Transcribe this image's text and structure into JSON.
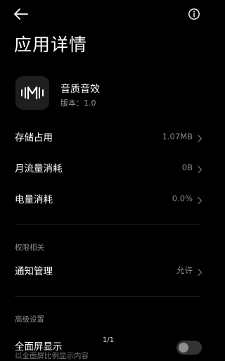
{
  "header": {
    "title": "应用详情",
    "back_icon": "arrow-left-icon",
    "info_icon": "info-circle-icon"
  },
  "app": {
    "name": "音质音效",
    "version": "版本：1.0",
    "icon": "sound-wave-m-icon"
  },
  "usage_rows": [
    {
      "label": "存储占用",
      "value": "1.07MB"
    },
    {
      "label": "月流量消耗",
      "value": "0B"
    },
    {
      "label": "电量消耗",
      "value": "0.0%"
    }
  ],
  "permissions": {
    "section_title": "权限相关",
    "notification_label": "通知管理",
    "notification_value": "允许"
  },
  "advanced": {
    "section_title": "高级设置",
    "fullscreen_label": "全面屏显示",
    "fullscreen_desc": "以全面屏比例显示内容",
    "fullscreen_enabled": false
  },
  "page_indicator": "1/1",
  "colors": {
    "background": "#000000",
    "primary_text": "#ffffff",
    "secondary_text": "#8c8c8c",
    "divider": "#1c1c1c",
    "toggle_off": "#333333"
  }
}
